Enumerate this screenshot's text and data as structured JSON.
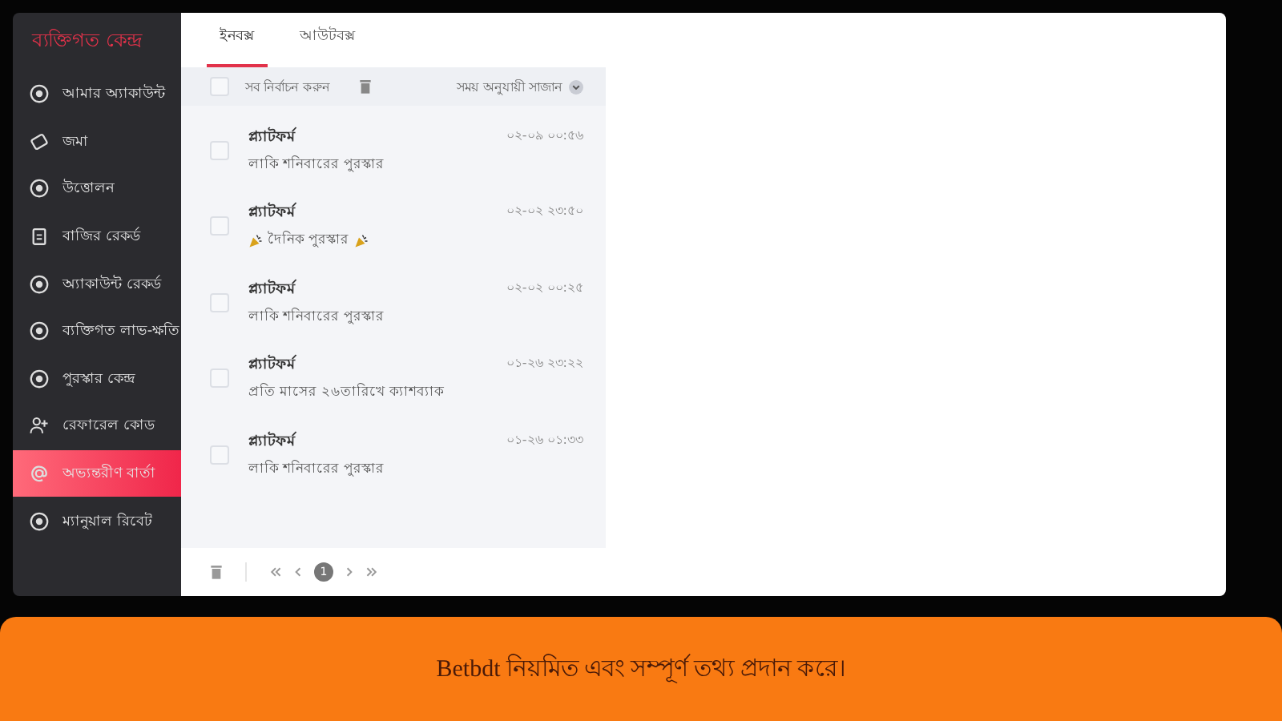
{
  "sidebar": {
    "title": "ব্যক্তিগত কেন্দ্র",
    "items": [
      {
        "label": "আমার অ্যাকাউন্ট",
        "selected": false
      },
      {
        "label": "জমা",
        "selected": false
      },
      {
        "label": "উত্তোলন",
        "selected": false
      },
      {
        "label": "বাজির রেকর্ড",
        "selected": false
      },
      {
        "label": "অ্যাকাউন্ট রেকর্ড",
        "selected": false
      },
      {
        "label": "ব্যক্তিগত লাভ-ক্ষতি",
        "selected": false
      },
      {
        "label": "পুরস্কার কেন্দ্র",
        "selected": false
      },
      {
        "label": "রেফারেল কোড",
        "selected": false
      },
      {
        "label": "অভ্যন্তরীণ বার্তা",
        "selected": true
      },
      {
        "label": "ম্যানুয়াল রিবেট",
        "selected": false
      }
    ]
  },
  "tabs": [
    {
      "label": "ইনবক্স",
      "selected": true
    },
    {
      "label": "আউটবক্স",
      "selected": false
    }
  ],
  "toolbar": {
    "select_all": "সব নির্বাচন করুন",
    "checked": false,
    "sort": "সময় অনুযায়ী সাজান"
  },
  "messages": [
    {
      "sender": "প্ল্যাটফর্ম",
      "subject": "লাকি শনিবারের পুরস্কার",
      "time": "০২-০৯ ০০:৫৬",
      "checked": false,
      "decorated": false
    },
    {
      "sender": "প্ল্যাটফর্ম",
      "subject": "দৈনিক পুরস্কার",
      "time": "০২-০২ ২৩:৫০",
      "checked": false,
      "decorated": true
    },
    {
      "sender": "প্ল্যাটফর্ম",
      "subject": "লাকি শনিবারের পুরস্কার",
      "time": "০২-০২ ০০:২৫",
      "checked": false,
      "decorated": false
    },
    {
      "sender": "প্ল্যাটফর্ম",
      "subject": "প্রতি মাসের ২৬তারিখে ক্যাশব্যাক",
      "time": "০১-২৬ ২৩:২২",
      "checked": false,
      "decorated": false
    },
    {
      "sender": "প্ল্যাটফর্ম",
      "subject": "লাকি শনিবারের পুরস্কার",
      "time": "০১-২৬ ০১:৩৩",
      "checked": false,
      "decorated": false
    }
  ],
  "pagination": {
    "pages": [
      {
        "label": "1",
        "selected": true
      }
    ]
  },
  "banner": {
    "text": "Betbdt নিয়মিত এবং সম্পূর্ণ তথ্য প্রদান করে।"
  }
}
